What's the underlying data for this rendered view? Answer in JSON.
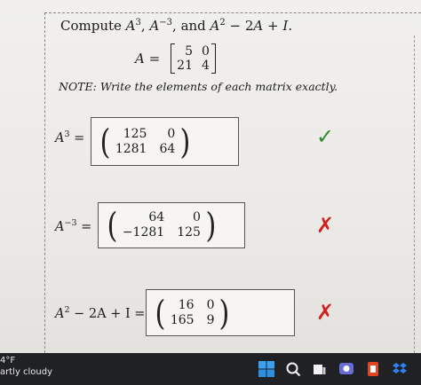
{
  "question": {
    "prefix": "Compute ",
    "terms": [
      "A",
      "3",
      ", ",
      "A",
      "−3",
      ", and ",
      "A",
      "2",
      " − 2",
      "A",
      " + ",
      "I",
      "."
    ]
  },
  "definition": {
    "lhs": "A =",
    "matrix": [
      [
        "5",
        "0"
      ],
      [
        "21",
        "4"
      ]
    ]
  },
  "note": "NOTE: Write the elements of each matrix exactly.",
  "answers": [
    {
      "lhs_base": "A",
      "lhs_exp": "3",
      "lhs_rest": " =",
      "matrix": [
        [
          "125",
          "0"
        ],
        [
          "1281",
          "64"
        ]
      ],
      "status": "correct",
      "mark": "✓"
    },
    {
      "lhs_base": "A",
      "lhs_exp": "−3",
      "lhs_rest": " =",
      "matrix": [
        [
          "64",
          "0"
        ],
        [
          "−1281",
          "125"
        ]
      ],
      "status": "incorrect",
      "mark": "✗"
    },
    {
      "lhs_base": "A",
      "lhs_exp": "2",
      "lhs_rest": " − 2A + I =",
      "matrix": [
        [
          "16",
          "0"
        ],
        [
          "165",
          "9"
        ]
      ],
      "status": "incorrect",
      "mark": "✗"
    }
  ],
  "taskbar": {
    "temperature": "4°F",
    "condition": "artly cloudy",
    "icons": [
      "windows-start-icon",
      "search-icon",
      "taskview-icon",
      "teams-icon",
      "office-icon",
      "dropbox-icon"
    ]
  },
  "colors": {
    "correct": "#2e8b2e",
    "incorrect": "#d12020",
    "taskbar": "#202125"
  }
}
